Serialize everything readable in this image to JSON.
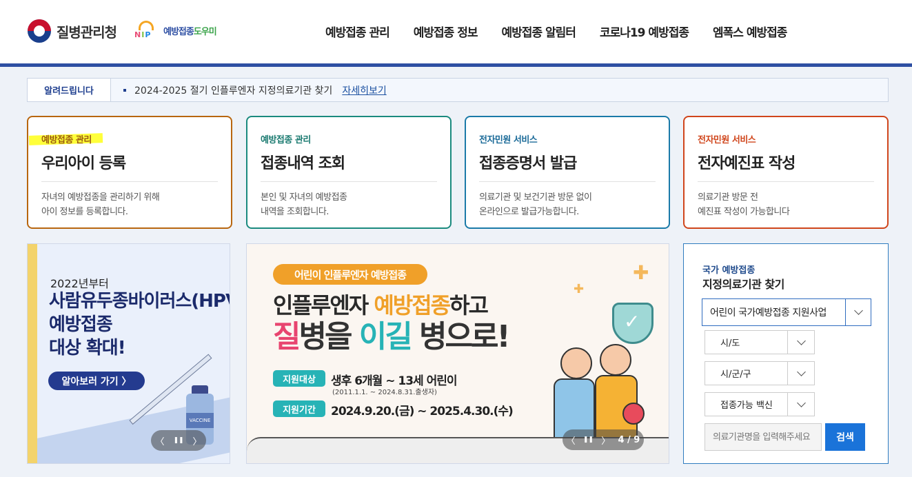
{
  "header": {
    "logo_text": "질병관리청",
    "nip_letters": [
      "N",
      "I",
      "P"
    ],
    "helper_logo_blue": "예방접종",
    "helper_logo_green": "도우미",
    "nav": [
      "예방접종 관리",
      "예방접종 정보",
      "예방접종 알림터",
      "코로나19 예방접종",
      "엠폭스 예방접종"
    ]
  },
  "notice": {
    "label": "알려드립니다",
    "text": "2024-2025 절기 인플루엔자 지정의료기관 찾기",
    "link": "자세히보기"
  },
  "cards": [
    {
      "category": "예방접종 관리",
      "title": "우리아이 등록",
      "desc1": "자녀의 예방접종을 관리하기 위해",
      "desc2": "아이 정보를 등록합니다.",
      "color": "#b8660f",
      "cat_color": "#9a5a12"
    },
    {
      "category": "예방접종 관리",
      "title": "접종내역 조회",
      "desc1": "본인 및 자녀의 예방접종",
      "desc2": "내역을 조회합니다.",
      "color": "#1a8a7e",
      "cat_color": "#1a7a70"
    },
    {
      "category": "전자민원 서비스",
      "title": "접종증명서 발급",
      "desc1": "의료기관 및 보건기관 방문 없이",
      "desc2": "온라인으로 발급가능합니다.",
      "color": "#1a7aa8",
      "cat_color": "#1a6a98"
    },
    {
      "category": "전자민원 서비스",
      "title": "전자예진표 작성",
      "desc1": "의료기관 방문 전",
      "desc2": "예진표 작성이 가능합니다",
      "color": "#d0451b",
      "cat_color": "#d0451b"
    }
  ],
  "banner_left": {
    "year": "2022년부터",
    "main": "사람유두종바이러스(HPV)\n예방접종\n대상 확대!",
    "button": "알아보러 가기  〉",
    "vial_label": "VACCINE",
    "pager_prev": "〈",
    "pager_pause": "❚❚",
    "pager_next": "〉"
  },
  "banner_center": {
    "pill": "어린이 인플루엔자 예방접종",
    "line1_a": "인플루엔자 ",
    "line1_b": "예방접종",
    "line1_c": "하고",
    "line2_a": "질",
    "line2_b": "병을 ",
    "line2_c": "이길",
    "line2_d": " 병으로!",
    "tag1": "지원대상",
    "info1": "생후 6개월 ~ 13세 어린이",
    "sub1": "(2011.1.1. ~ 2024.8.31.출생자)",
    "tag2": "지원기간",
    "info2": "2024.9.20.(금) ~ 2025.4.30.(수)",
    "pager_prev": "〈",
    "pager_pause": "❚❚",
    "pager_next": "〉",
    "pager_count": "4 / 9"
  },
  "search": {
    "category": "국가 예방접종",
    "title": "지정의료기관 찾기",
    "program": "어린이 국가예방접종 지원사업",
    "sido": "시/도",
    "sigungu": "시/군/구",
    "vaccine": "접종가능 백신",
    "input_placeholder": "의료기관명을 입력해주세요",
    "button": "검색"
  }
}
